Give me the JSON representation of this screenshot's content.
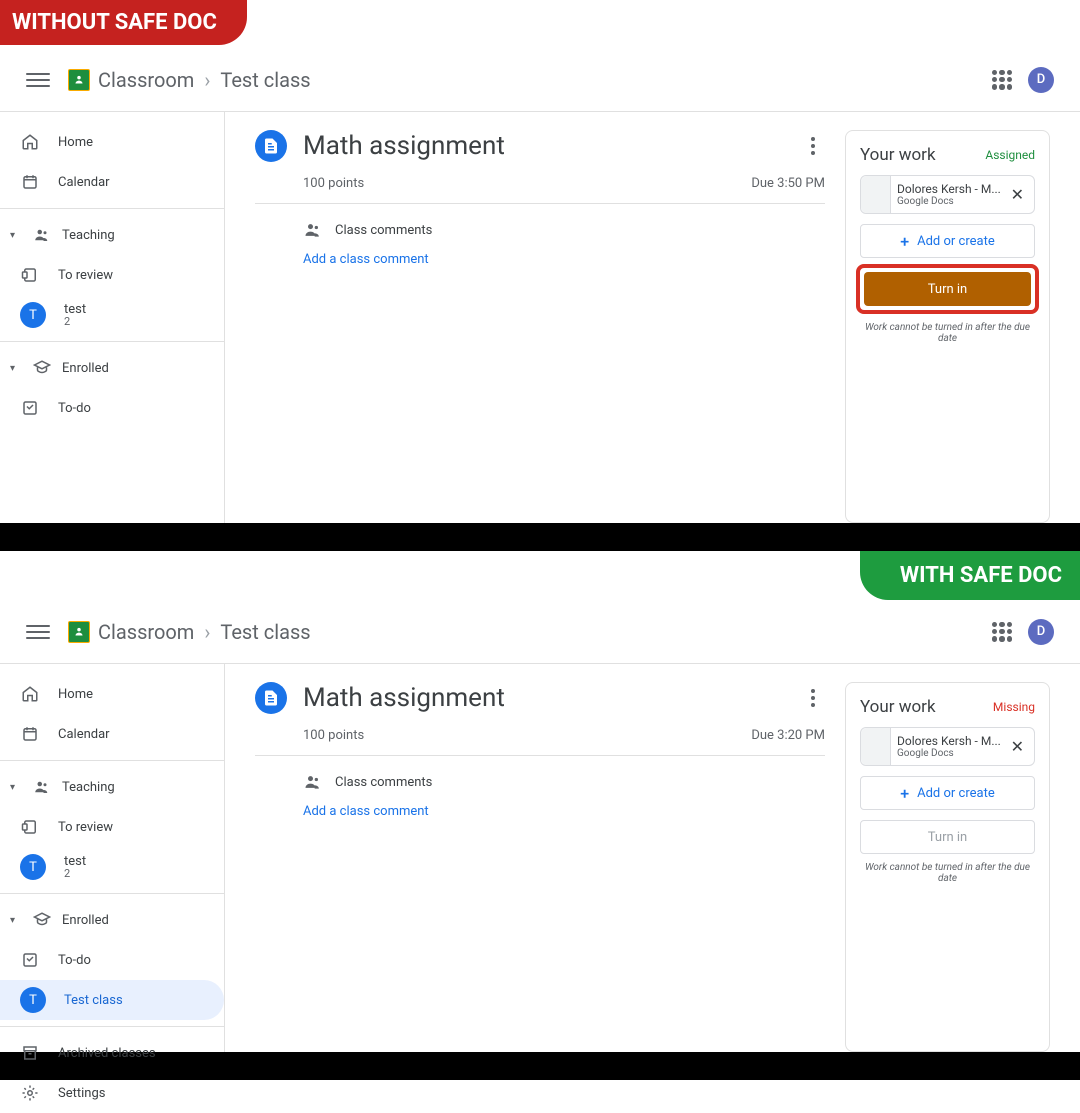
{
  "banners": {
    "without": "WITHOUT SAFE DOC",
    "with": "WITH SAFE DOC"
  },
  "header": {
    "app": "Classroom",
    "crumb": "Test class",
    "avatar": "D"
  },
  "sidebar": {
    "home": "Home",
    "calendar": "Calendar",
    "teaching": "Teaching",
    "review": "To review",
    "testclass": "test",
    "testclass_sub": "2",
    "enrolled": "Enrolled",
    "todo": "To-do",
    "testclass2": "Test class",
    "archived": "Archived classes",
    "settings": "Settings",
    "badge": "T"
  },
  "assignment": {
    "title": "Math assignment",
    "points": "100 points",
    "due_top": "Due 3:50 PM",
    "due_bottom": "Due 3:20 PM",
    "comments": "Class comments",
    "add_comment": "Add a class comment"
  },
  "work": {
    "title": "Your work",
    "status_assigned": "Assigned",
    "status_missing": "Missing",
    "att_name": "Dolores Kersh - M...",
    "att_type": "Google Docs",
    "add_create": "Add or create",
    "turn_in": "Turn in",
    "note": "Work cannot be turned in after the due date"
  }
}
